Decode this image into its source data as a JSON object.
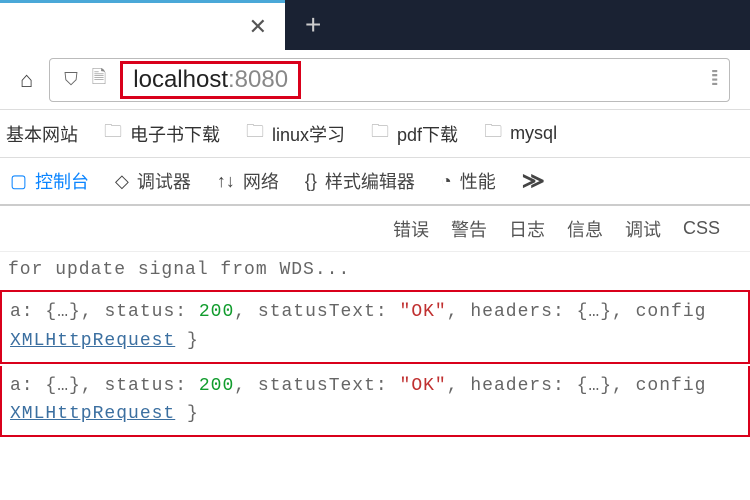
{
  "tabbar": {
    "close_glyph": "✕",
    "plus_glyph": "+"
  },
  "address": {
    "host": "localhost",
    "port": ":8080",
    "shield_glyph": "⛉",
    "page_glyph": "🗎",
    "qr_glyph": "⁞⁞⁞",
    "home_glyph": "⌂"
  },
  "bookmarks": {
    "items": [
      {
        "label": "基本网站"
      },
      {
        "label": "电子书下载"
      },
      {
        "label": "linux学习"
      },
      {
        "label": "pdf下载"
      },
      {
        "label": "mysql"
      }
    ],
    "folder_glyph": "🗀"
  },
  "devtools": {
    "tabs": [
      {
        "icon": "▢",
        "label": "控制台",
        "active": true
      },
      {
        "icon": "◇",
        "label": "调试器"
      },
      {
        "icon": "↑↓",
        "label": "网络"
      },
      {
        "icon": "{}",
        "label": "样式编辑器"
      },
      {
        "icon": "◔",
        "label": "性能"
      }
    ],
    "more_glyph": "≫"
  },
  "filters": {
    "items": [
      "错误",
      "警告",
      "日志",
      "信息",
      "调试",
      "CSS"
    ]
  },
  "console": {
    "wait_line": "for update signal from WDS...",
    "responses": [
      {
        "prefix": "a:",
        "obj1": "{…}",
        "status_key": "status:",
        "status_val": "200",
        "statusText_key": "statusText:",
        "statusText_val": "\"OK\"",
        "headers_key": "headers:",
        "obj2": "{…}",
        "config_key": "config",
        "xhr": "XMLHttpRequest",
        "tail": " }"
      },
      {
        "prefix": "a:",
        "obj1": "{…}",
        "status_key": "status:",
        "status_val": "200",
        "statusText_key": "statusText:",
        "statusText_val": "\"OK\"",
        "headers_key": "headers:",
        "obj2": "{…}",
        "config_key": "config",
        "xhr": "XMLHttpRequest",
        "tail": " }"
      }
    ]
  }
}
